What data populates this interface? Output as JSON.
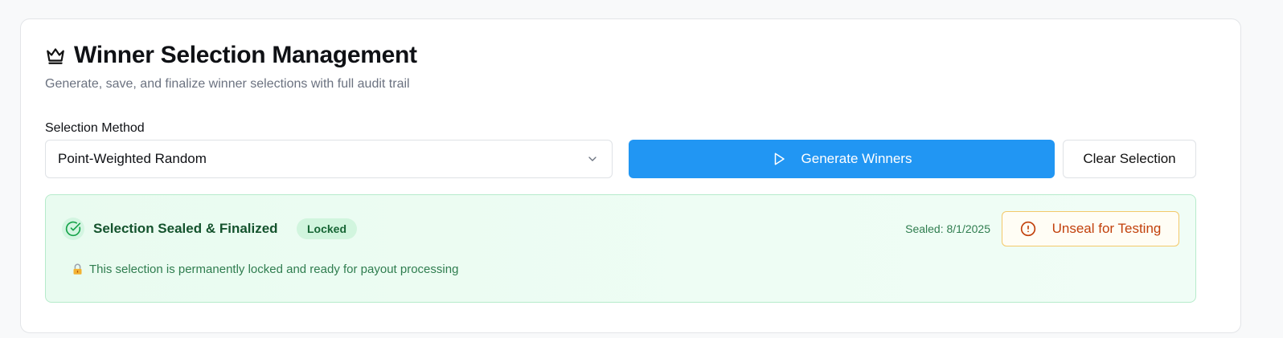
{
  "header": {
    "title": "Winner Selection Management",
    "subtitle": "Generate, save, and finalize winner selections with full audit trail"
  },
  "selection": {
    "label": "Selection Method",
    "value": "Point-Weighted Random"
  },
  "actions": {
    "generate_label": "Generate Winners",
    "clear_label": "Clear Selection"
  },
  "status": {
    "title": "Selection Sealed & Finalized",
    "badge": "Locked",
    "sealed_date": "Sealed: 8/1/2025",
    "unseal_label": "Unseal for Testing",
    "note": "This selection is permanently locked and ready for payout processing"
  },
  "icons": {
    "title_icon": "crown-icon",
    "select_icon": "chevron-down-icon",
    "generate_icon": "play-icon",
    "status_icon": "check-circle-icon",
    "unseal_icon": "alert-circle-icon",
    "note_icon": "lock-icon"
  },
  "colors": {
    "primary": "#2196f3",
    "success_text": "#14532d",
    "success_bg": "#e9fbf0",
    "warning_text": "#c2410c",
    "warning_border": "#f3c96a"
  }
}
